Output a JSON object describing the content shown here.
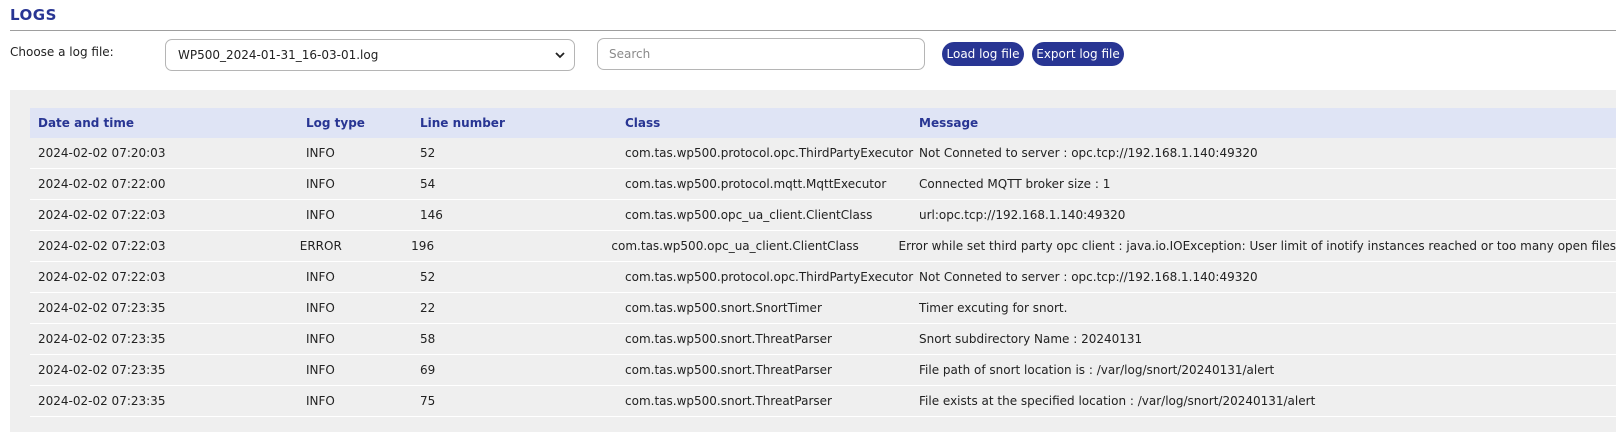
{
  "page": {
    "title": "LOGS"
  },
  "toolbar": {
    "file_label": "Choose a log file:",
    "selected_file": "WP500_2024-01-31_16-03-01.log",
    "search_placeholder": "Search",
    "load_label": "Load log file",
    "export_label": "Export log file"
  },
  "colors": {
    "accent": "#283593",
    "header_bg": "#dfe4f5",
    "panel_bg": "#efefef"
  },
  "table": {
    "headers": {
      "date": "Date and time",
      "type": "Log type",
      "line": "Line number",
      "class": "Class",
      "message": "Message"
    },
    "rows": [
      {
        "date": "2024-02-02 07:20:03",
        "type": "INFO",
        "line": "52",
        "class": "com.tas.wp500.protocol.opc.ThirdPartyExecutor",
        "message": "Not Conneted to server : opc.tcp://192.168.1.140:49320"
      },
      {
        "date": "2024-02-02 07:22:00",
        "type": "INFO",
        "line": "54",
        "class": "com.tas.wp500.protocol.mqtt.MqttExecutor",
        "message": "Connected MQTT broker size : 1"
      },
      {
        "date": "2024-02-02 07:22:03",
        "type": "INFO",
        "line": "146",
        "class": "com.tas.wp500.opc_ua_client.ClientClass",
        "message": "url:opc.tcp://192.168.1.140:49320"
      },
      {
        "date": "2024-02-02 07:22:03",
        "type": "ERROR",
        "line": "196",
        "class": "com.tas.wp500.opc_ua_client.ClientClass",
        "message": "Error while set third party opc client : java.io.IOException: User limit of inotify instances reached or too many open files"
      },
      {
        "date": "2024-02-02 07:22:03",
        "type": "INFO",
        "line": "52",
        "class": "com.tas.wp500.protocol.opc.ThirdPartyExecutor",
        "message": "Not Conneted to server : opc.tcp://192.168.1.140:49320"
      },
      {
        "date": "2024-02-02 07:23:35",
        "type": "INFO",
        "line": "22",
        "class": "com.tas.wp500.snort.SnortTimer",
        "message": "Timer excuting for snort."
      },
      {
        "date": "2024-02-02 07:23:35",
        "type": "INFO",
        "line": "58",
        "class": "com.tas.wp500.snort.ThreatParser",
        "message": "Snort subdirectory Name : 20240131"
      },
      {
        "date": "2024-02-02 07:23:35",
        "type": "INFO",
        "line": "69",
        "class": "com.tas.wp500.snort.ThreatParser",
        "message": "File path of snort location is : /var/log/snort/20240131/alert"
      },
      {
        "date": "2024-02-02 07:23:35",
        "type": "INFO",
        "line": "75",
        "class": "com.tas.wp500.snort.ThreatParser",
        "message": "File exists at the specified location : /var/log/snort/20240131/alert"
      }
    ]
  }
}
